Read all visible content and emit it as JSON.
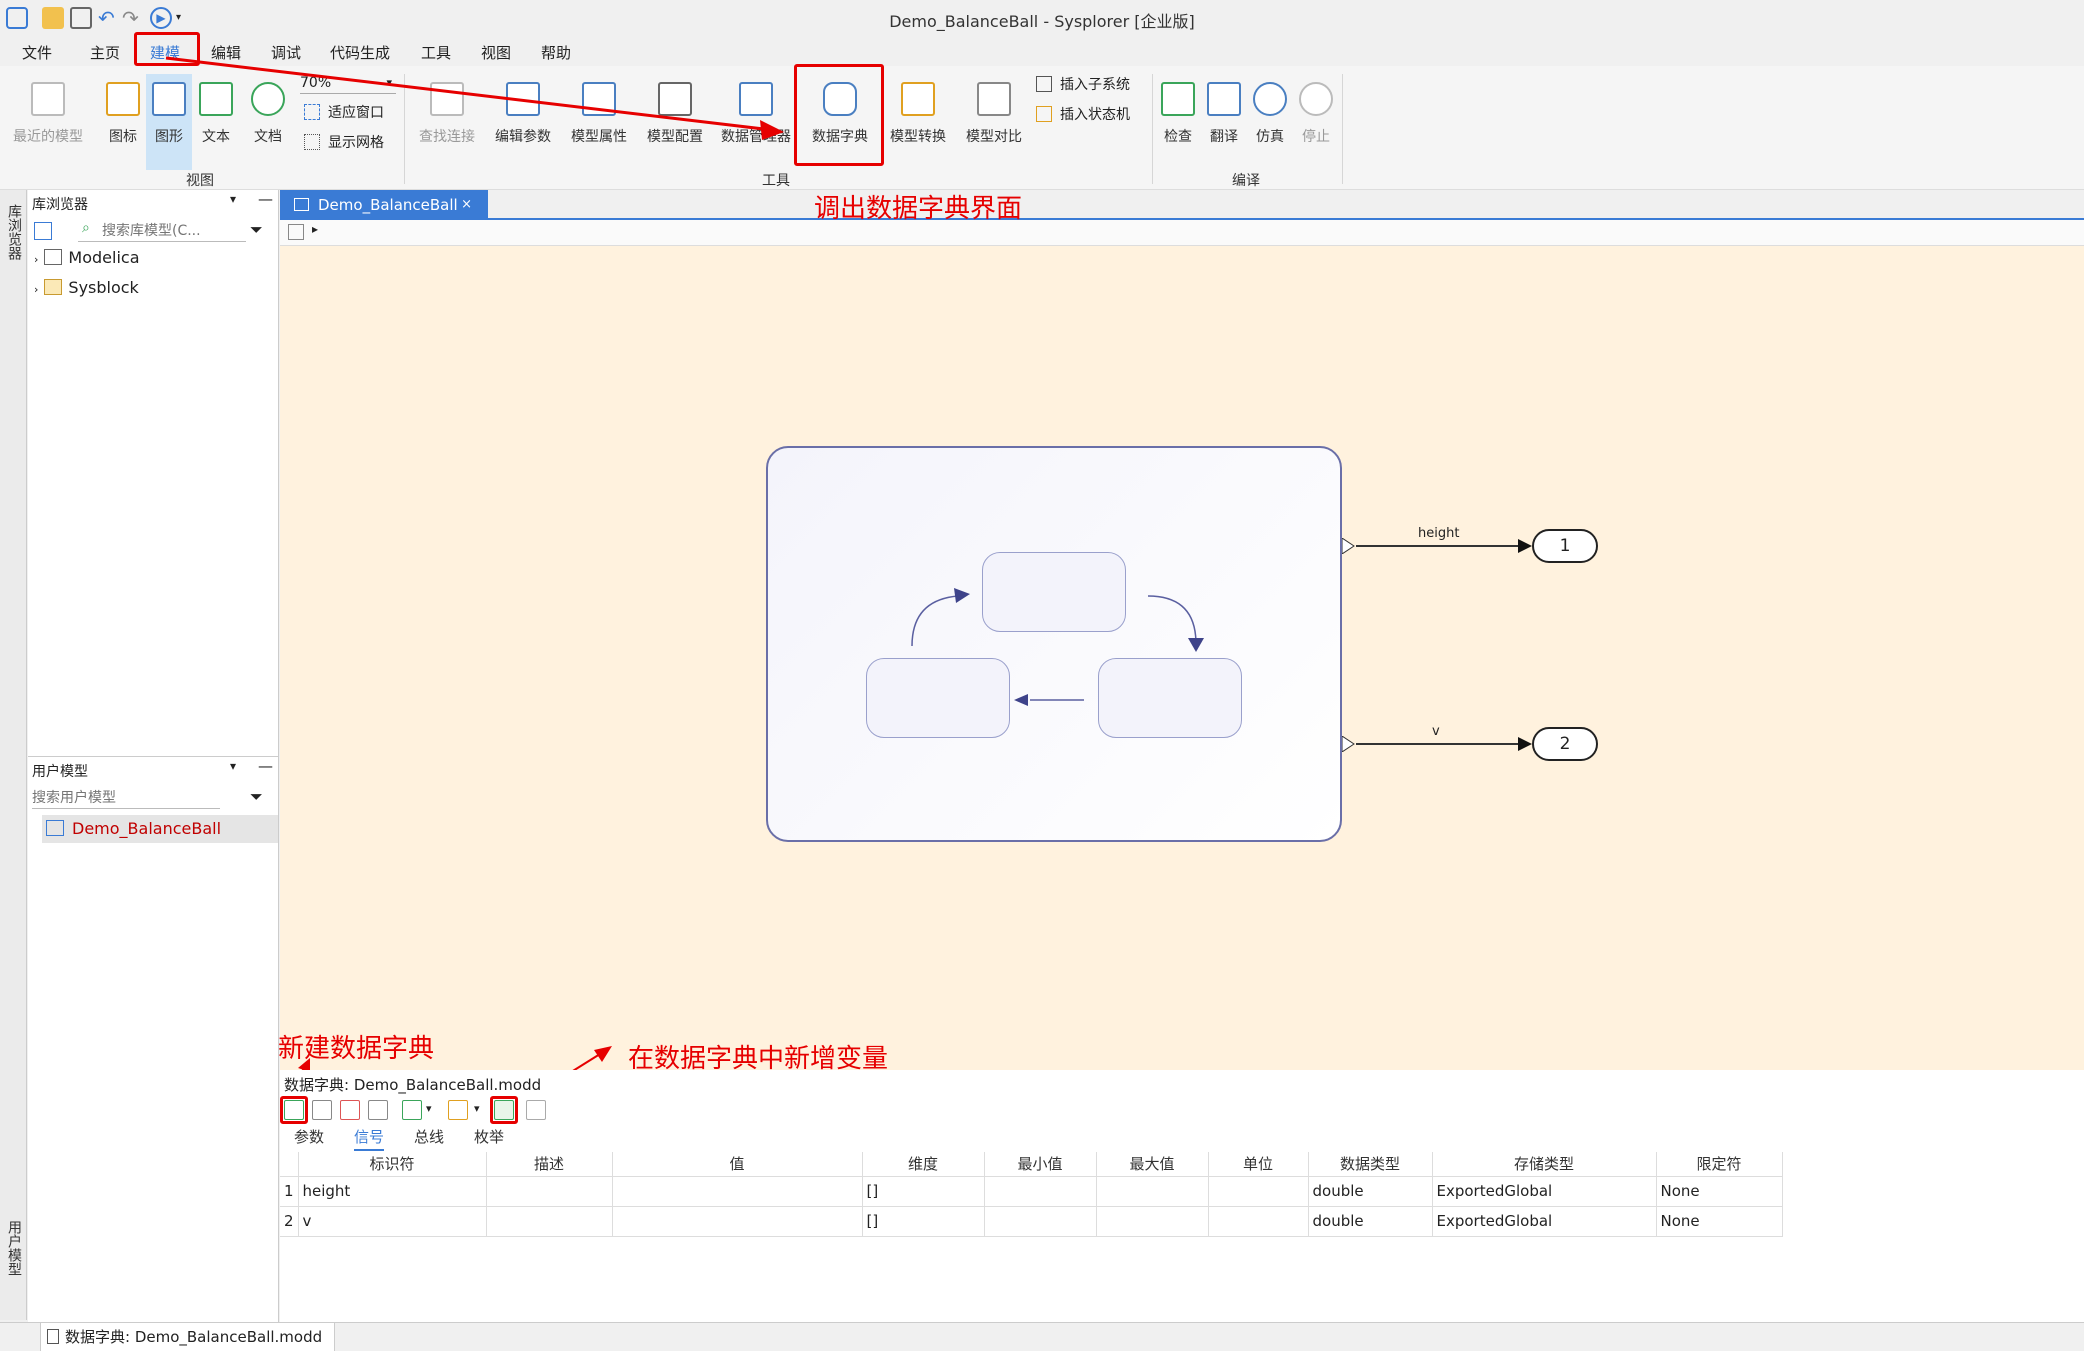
{
  "window": {
    "title": "Demo_BalanceBall - Sysplorer [企业版]"
  },
  "menu": [
    "文件",
    "主页",
    "建模",
    "编辑",
    "调试",
    "代码生成",
    "工具",
    "视图",
    "帮助"
  ],
  "ribbon": {
    "view": {
      "recent": "最近的模型",
      "icon": "图标",
      "diagram": "图形",
      "text": "文本",
      "doc": "文档",
      "zoom": "70%",
      "fit": "适应窗口",
      "grid": "显示网格",
      "group": "视图"
    },
    "tools": {
      "find": "查找连接",
      "edit_params": "编辑参数",
      "model_props": "模型属性",
      "model_config": "模型配置",
      "data_mgr": "数据管理器",
      "data_dict": "数据字典",
      "model_convert": "模型转换",
      "model_compare": "模型对比",
      "insert_subsystem": "插入子系统",
      "insert_statemachine": "插入状态机",
      "group": "工具"
    },
    "compile": {
      "check": "检查",
      "translate": "翻译",
      "simulate": "仿真",
      "stop": "停止",
      "group": "编译"
    }
  },
  "left": {
    "vtab_lib": "库浏览器",
    "vtab_user": "用户模型",
    "lib": {
      "title": "库浏览器",
      "search_placeholder": "搜索库模型(C...",
      "items": [
        "Modelica",
        "Sysblock"
      ]
    },
    "user": {
      "title": "用户模型",
      "search_placeholder": "搜索用户模型",
      "items": [
        "Demo_BalanceBall"
      ]
    }
  },
  "editor": {
    "tab": "Demo_BalanceBall",
    "signals": [
      {
        "label": "height",
        "port": "1"
      },
      {
        "label": "v",
        "port": "2"
      }
    ]
  },
  "annotations": {
    "open_dict": "调出数据字典界面",
    "new_dict": "新建数据字典",
    "add_var": "在数据字典中新增变量"
  },
  "dict": {
    "title": "数据字典: Demo_BalanceBall.modd",
    "tabs": [
      "参数",
      "信号",
      "总线",
      "枚举"
    ],
    "active_tab": "信号",
    "columns": [
      "标识符",
      "描述",
      "值",
      "维度",
      "最小值",
      "最大值",
      "单位",
      "数据类型",
      "存储类型",
      "限定符"
    ],
    "rows": [
      {
        "n": "1",
        "id": "height",
        "desc": "",
        "val": "",
        "dim": "[]",
        "min": "",
        "max": "",
        "unit": "",
        "type": "double",
        "storage": "ExportedGlobal",
        "qual": "None"
      },
      {
        "n": "2",
        "id": "v",
        "desc": "",
        "val": "",
        "dim": "[]",
        "min": "",
        "max": "",
        "unit": "",
        "type": "double",
        "storage": "ExportedGlobal",
        "qual": "None"
      }
    ]
  },
  "status": {
    "text": "数据字典: Demo_BalanceBall.modd"
  },
  "colors": {
    "accent": "#3a7bd5",
    "annotation": "#e60000",
    "canvas": "#fff2de"
  }
}
